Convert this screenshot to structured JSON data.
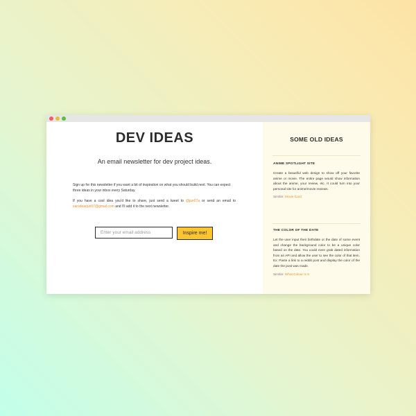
{
  "window": {
    "controls": [
      "close-icon",
      "minimize-icon",
      "maximize-icon"
    ]
  },
  "main": {
    "title": "DEV IDEAS",
    "subtitle": "An email newsletter for dev project ideas.",
    "intro_p1": "Sign up for this newsletter if you want a bit of inspiration on what you should build next. You can expect three ideas in your inbox every Saturday.",
    "intro_p2_before": "If you have a cool idea you'd like to share, just send a tweet to ",
    "twitter_link": "@jun07a",
    "intro_p2_middle": " or send an email to ",
    "email_link": "sarodearjun57@gmail.com",
    "intro_p2_after": " and I'll add it to the next newsletter.",
    "email_placeholder": "Enter your email address",
    "email_value": "",
    "button_label": "Inspire me!"
  },
  "sidebar": {
    "title": "SOME OLD IDEAS",
    "ideas": [
      {
        "title": "ANIME SPOTLIGHT SITE",
        "description": "Create a beautiful web design to show off your favorite anime or movie. The entire page would show information about the anime, your review, etc. It could turn into your personal site for anime/movie reviews.",
        "similar_label": "Similar: ",
        "similar_link": "Movie Card"
      },
      {
        "title": "THE COLOR OF THE DATE",
        "description": "Let the user input their birthdate or the date of some event and change the background color to be a unique color based on the date. You could even grab dated information from an API and allow the user to see the color of that item. Ex: Paste a link to a reddit post and display the color of the date the post was made.",
        "similar_label": "Similar: ",
        "similar_link": "What Colour Is It"
      }
    ]
  },
  "colors": {
    "accent_link": "#e8902a",
    "button": "#fbc531",
    "sidebar_bg": "#fffbea",
    "text": "#2b2b2b"
  }
}
